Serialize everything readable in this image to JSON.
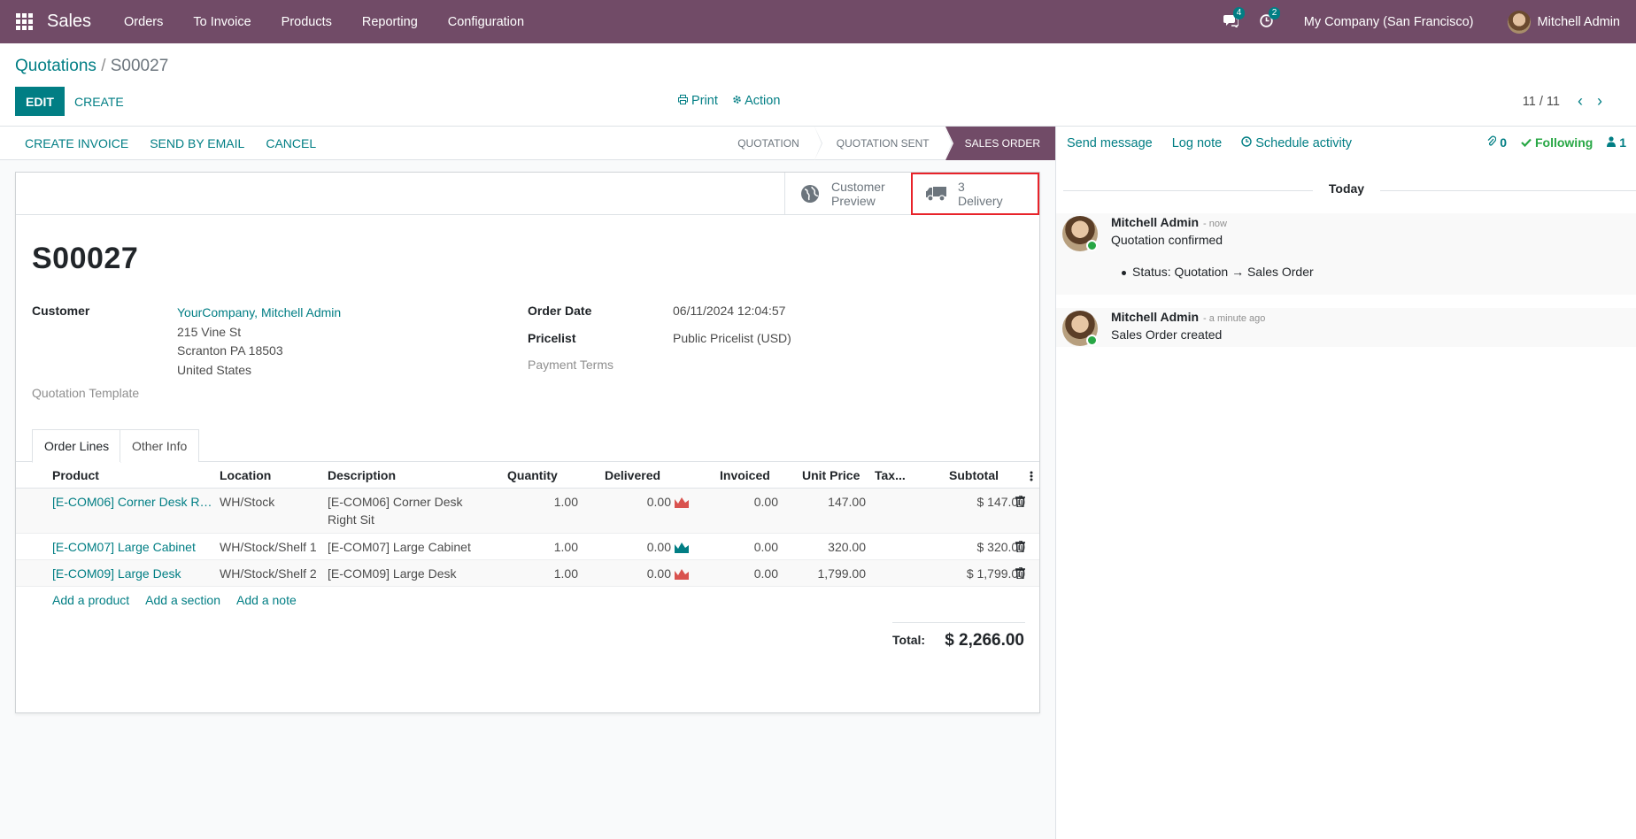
{
  "navbar": {
    "app_name": "Sales",
    "menu": [
      "Orders",
      "To Invoice",
      "Products",
      "Reporting",
      "Configuration"
    ],
    "messages_count": "4",
    "activities_count": "2",
    "company": "My Company (San Francisco)",
    "user": "Mitchell Admin"
  },
  "breadcrumb": {
    "parent": "Quotations",
    "separator": "/",
    "current": "S00027"
  },
  "buttons": {
    "edit": "EDIT",
    "create": "CREATE",
    "print": "Print",
    "action": "Action"
  },
  "pager": {
    "value": "11 / 11"
  },
  "statusbar": {
    "actions": [
      "CREATE INVOICE",
      "SEND BY EMAIL",
      "CANCEL"
    ],
    "stages": [
      "QUOTATION",
      "QUOTATION SENT",
      "SALES ORDER"
    ],
    "active_stage": "SALES ORDER"
  },
  "smart_buttons": {
    "preview_line1": "Customer",
    "preview_line2": "Preview",
    "delivery_count": "3",
    "delivery_label": "Delivery"
  },
  "order": {
    "name": "S00027",
    "customer_label": "Customer",
    "customer_name": "YourCompany, Mitchell Admin",
    "address1": "215 Vine St",
    "address2": "Scranton PA 18503",
    "address3": "United States",
    "template_label": "Quotation Template",
    "order_date_label": "Order Date",
    "order_date": "06/11/2024 12:04:57",
    "pricelist_label": "Pricelist",
    "pricelist": "Public Pricelist (USD)",
    "payment_terms_label": "Payment Terms"
  },
  "tabs": [
    "Order Lines",
    "Other Info"
  ],
  "table": {
    "headers": [
      "Product",
      "Location",
      "Description",
      "Quantity",
      "Delivered",
      "Invoiced",
      "Unit Price",
      "Tax...",
      "Subtotal"
    ],
    "rows": [
      {
        "product": "[E-COM06] Corner Desk Right Sit",
        "location": "WH/Stock",
        "description": "[E-COM06] Corner Desk Right Sit",
        "quantity": "1.00",
        "delivered": "0.00",
        "invoiced": "0.00",
        "unit_price": "147.00",
        "subtotal": "$ 147.00",
        "forecast_color": "#d9534f"
      },
      {
        "product": "[E-COM07] Large Cabinet",
        "location": "WH/Stock/Shelf 1",
        "description": "[E-COM07] Large Cabinet",
        "quantity": "1.00",
        "delivered": "0.00",
        "invoiced": "0.00",
        "unit_price": "320.00",
        "subtotal": "$ 320.00",
        "forecast_color": "#017e84"
      },
      {
        "product": "[E-COM09] Large Desk",
        "location": "WH/Stock/Shelf 2",
        "description": "[E-COM09] Large Desk",
        "quantity": "1.00",
        "delivered": "0.00",
        "invoiced": "0.00",
        "unit_price": "1,799.00",
        "subtotal": "$ 1,799.00",
        "forecast_color": "#d9534f"
      }
    ],
    "add_links": [
      "Add a product",
      "Add a section",
      "Add a note"
    ],
    "total_label": "Total:",
    "total_value": "$ 2,266.00"
  },
  "chatter": {
    "send_message": "Send message",
    "log_note": "Log note",
    "schedule_activity": "Schedule activity",
    "attachments": "0",
    "following": "Following",
    "followers": "1",
    "date_separator": "Today",
    "messages": [
      {
        "author": "Mitchell Admin",
        "time": "- now",
        "body": "Quotation confirmed",
        "tracking": "Status: Quotation → Sales Order"
      },
      {
        "author": "Mitchell Admin",
        "time": "- a minute ago",
        "body": "Sales Order created"
      }
    ]
  }
}
